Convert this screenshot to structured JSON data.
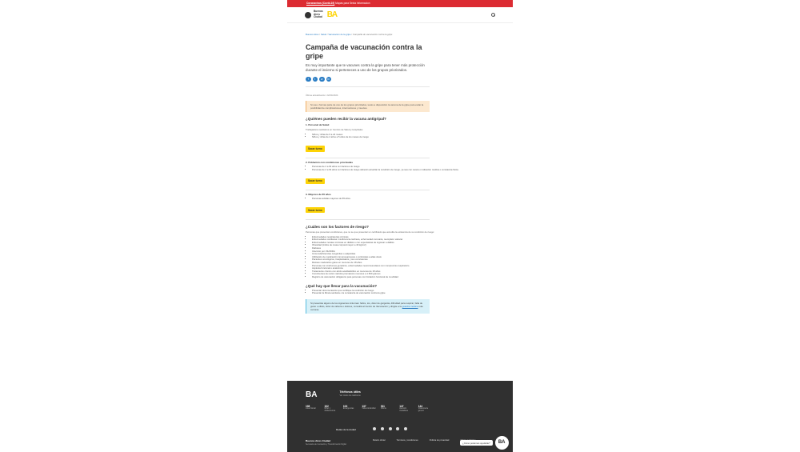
{
  "topbar": {
    "alert_link": "Coronavirus (Covid-19)",
    "alert_text": "Mapas para Sexta Informacion"
  },
  "header": {
    "logo_line1": "Buenos",
    "logo_line2": "Aires",
    "logo_line3": "Ciudad",
    "brand": "BA",
    "search_icon": "search-icon"
  },
  "breadcrumb": {
    "items": [
      "Buenos Aires",
      "Salud",
      "Vacunacion de la gripe"
    ],
    "current": "Campaña de vacunación contra la gripe"
  },
  "article": {
    "title": "Campaña de vacunación contra la gripe",
    "lead": "Es muy importante que te vacunes contra la gripe para tener más protección durante el invierno si perteneces a uno de los grupos priorizados.",
    "updated": "Última actualización: 22/04/2024",
    "warning": "Si sos o formas parte de uno de los grupos priorizados, tenés a disposición la vacuna de la gripe para evitar la posibilidad de complicaciones, internaciones y muertes.",
    "section1_title": "¿Quiénes pueden recibir la vacuna antigripal?",
    "group1_title": "1. Personal de Salud",
    "group1_text": "Trabajadores sanitarios en Centros de Salud y Hospitales",
    "group1_items": [
      "Niños y niñas de 6 a 24 meses",
      "Niños y niñas de 2 años a 5 años de los meses de riesgo"
    ],
    "book_button": "Sacar turno",
    "group2_title": "2. Población con condiciones priorizadas",
    "group2_items": [
      "Personas de 2 a 64 años con factores de riesgo",
      "Personas de 2 a 64 años con factores de riesgo deberán acreditar la condición de riesgo, ya sea con receta o indicación médica o constancia física."
    ],
    "group3_title": "3. Mayores de 65 años",
    "group3_items": [
      "Personas adultas mayores de 65 años."
    ],
    "section2_title": "¿Cuáles son los factores de riesgo?",
    "section2_text": "Personas que presentan condiciones, que no se que presentar un certificado que acredite la existencia de su condición de riesgo:",
    "risk_items": [
      "Enfermedades respiratorias crónicas",
      "Enfermedades cardíacas: insuficiencia cardíaca, enfermedad coronaria, reemplazo valvular",
      "Enfermedades renales crónicas en diálisis o con expectativas de ingresar a diálisis",
      "Obesidad (índice de masa corporal mayor a 40 kg/m2)",
      "Diabetes",
      "Infección por VIH/SIDA",
      "Inmunodeficiencias congénitas o adquiridas",
      "Utilización de medicación inmunosupresora o corticoides a altas dosis",
      "Pacientes oncológicos, trasplantados y sus convivientes",
      "Retraso madurativo grave en menores de 18 años",
      "Personas con síndromes genéticos, enfermedades neuromusculares con compromiso respiratorio",
      "Asplenia funcional o anatómica",
      "Tratamiento crónico con ácido acetilsalicílico en menores de 18 años",
      "Convivientes de recién nacidos prematuros menores a 1.500 gramos",
      "Registro de vacunación obligatorio para personas con limitación funcional de movilidad"
    ],
    "section3_title": "¿Qué hay que llevar para la vacunación?",
    "bring_items": [
      "Presentar documentación que certifique la condición de riesgo",
      "Presentar la libreta sanitaria o la constancia de vacunación contra la gripe"
    ],
    "info_text": "Si presentás alguno de los siguientes síntomas: fiebre, tos, dolor de garganta, dificultad para respirar, falta de gusto u olfato, dolor de cabeza o dolores, consultá al Centro de Vacunación y dirigite a la",
    "info_link": "guardia médica",
    "info_tail": "más cercana."
  },
  "footer": {
    "logo": "BA",
    "phones_title": "Teléfonos útiles",
    "phones_subtitle": "Ver todos los teléfonos",
    "phones": [
      {
        "number": "108",
        "desc": "Línea Social"
      },
      {
        "number": "102",
        "desc": "Niñez y Adolescencia"
      },
      {
        "number": "103",
        "desc": "Emergencias"
      },
      {
        "number": "137",
        "desc": "Violencia familiar"
      },
      {
        "number": "911",
        "desc": "Policía"
      },
      {
        "number": "147",
        "desc": "Atención ciudadana"
      },
      {
        "number": "144",
        "desc": "Violencia de género"
      }
    ],
    "social_label": "Redes de la ciudad",
    "city_name": "Buenos Aires Ciudad",
    "city_text": "Secretaría de Innovación y Transformación Digital",
    "links": [
      "Boletín oficial",
      "Términos y condiciones",
      "Política de privacidad",
      "Oficios judiciales"
    ],
    "chat_tip": "¿Cómo podemos ayudarte?",
    "chat_brand": "BA"
  }
}
